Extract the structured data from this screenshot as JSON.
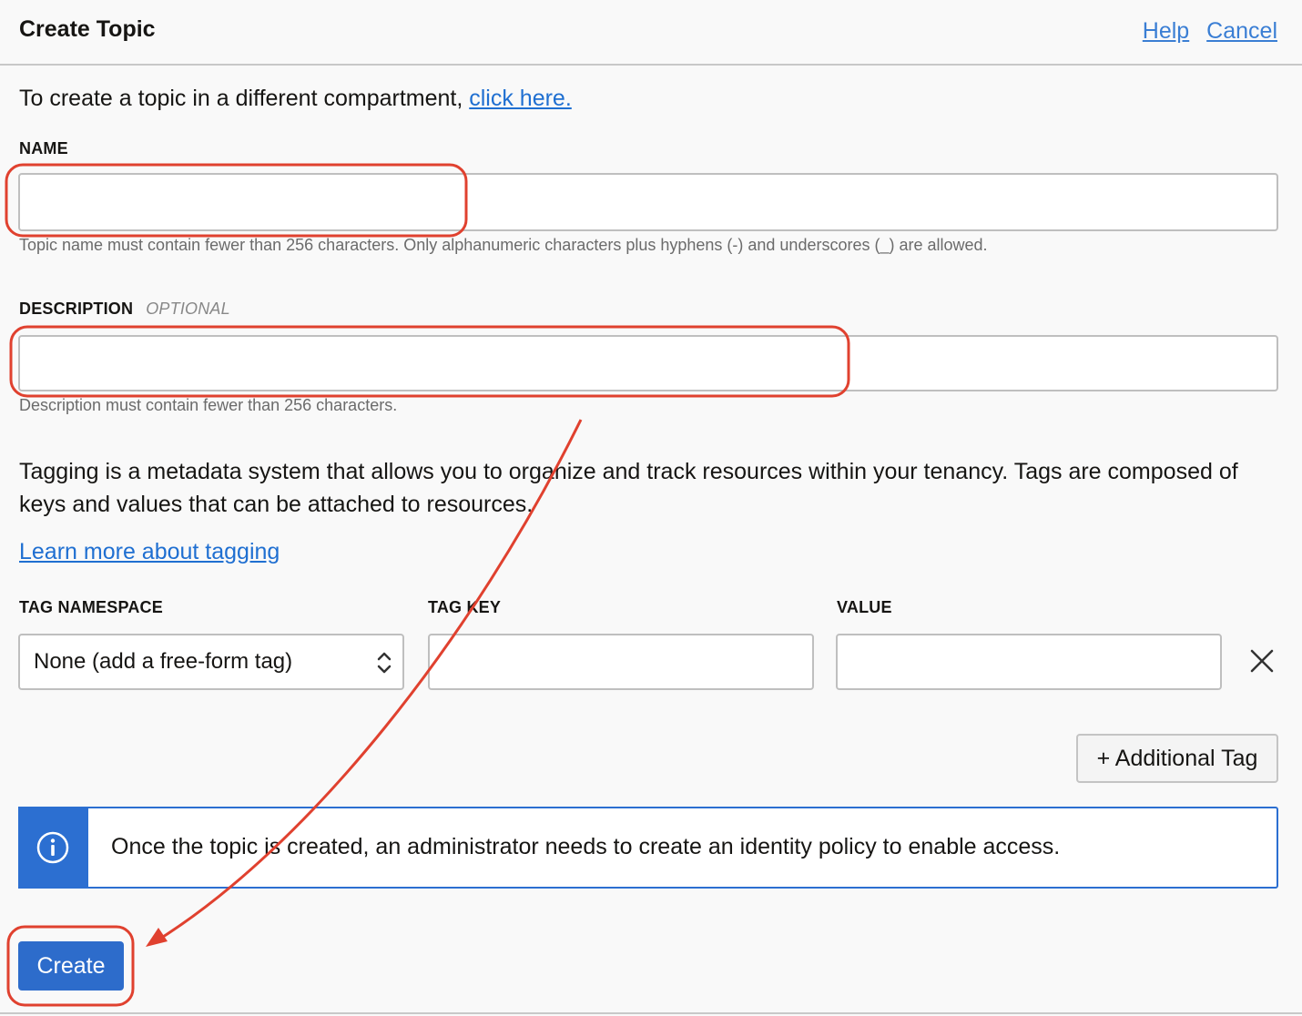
{
  "header": {
    "title": "Create Topic",
    "help_label": "Help",
    "cancel_label": "Cancel"
  },
  "compartment": {
    "text": "To create a topic in a different compartment, ",
    "link_label": "click here."
  },
  "name_field": {
    "label": "NAME",
    "value": "",
    "helper": "Topic name must contain fewer than 256 characters. Only alphanumeric characters plus hyphens (-) and underscores (_) are allowed."
  },
  "description_field": {
    "label": "DESCRIPTION",
    "optional_label": "OPTIONAL",
    "value": "",
    "helper": "Description must contain fewer than 256 characters."
  },
  "tagging": {
    "description": "Tagging is a metadata system that allows you to organize and track resources within your tenancy. Tags are composed of keys and values that can be attached to resources.",
    "learn_more_label": "Learn more about tagging",
    "namespace_label": "TAG NAMESPACE",
    "key_label": "TAG KEY",
    "value_label": "VALUE",
    "namespace_selected": "None (add a free-form tag)",
    "key_value": "",
    "value_value": "",
    "add_tag_label": "+ Additional Tag"
  },
  "info": {
    "message": "Once the topic is created, an administrator needs to create an identity policy to enable access.",
    "icon": "info-icon"
  },
  "actions": {
    "create_label": "Create"
  },
  "colors": {
    "primary": "#2d6ccb",
    "link": "#1f6fd1",
    "annotation": "#e0412f"
  }
}
